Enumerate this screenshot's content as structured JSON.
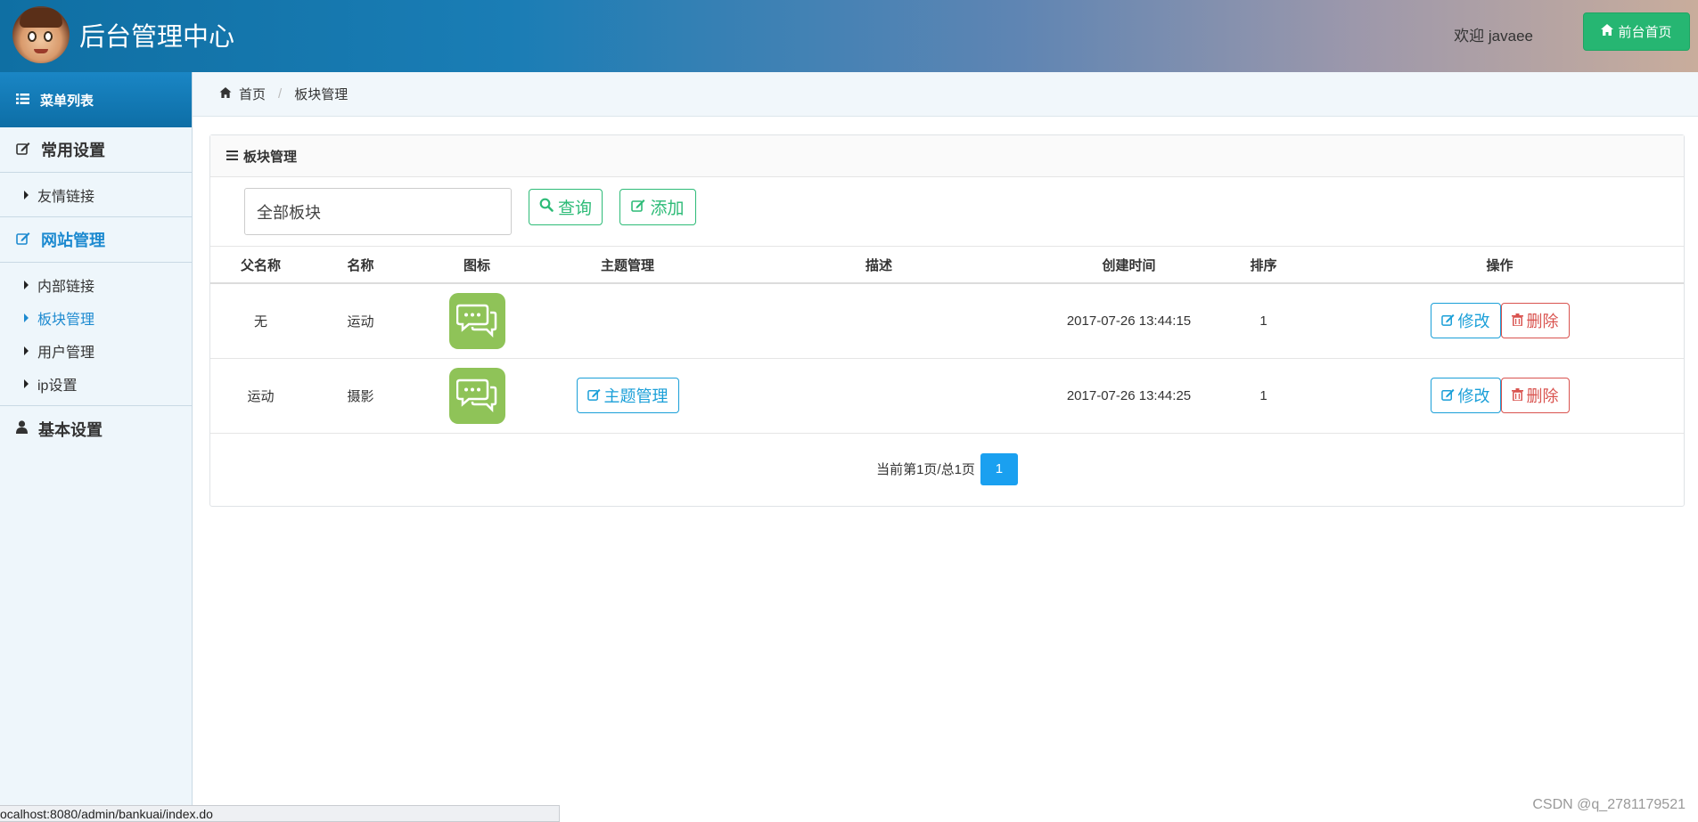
{
  "header": {
    "title": "后台管理中心",
    "welcome": "欢迎 javaee",
    "home_button": "前台首页"
  },
  "sidebar": {
    "menu_title": "菜单列表",
    "groups": [
      {
        "label": "常用设置",
        "items": [
          "友情链接"
        ]
      },
      {
        "label": "网站管理",
        "items": [
          "内部链接",
          "板块管理",
          "用户管理",
          "ip设置"
        ]
      },
      {
        "label": "基本设置",
        "items": []
      }
    ],
    "active_group": "网站管理",
    "active_item": "板块管理"
  },
  "breadcrumb": {
    "home": "首页",
    "current": "板块管理"
  },
  "panel": {
    "title": "板块管理",
    "filter_value": "全部板块",
    "query_button": "查询",
    "add_button": "添加"
  },
  "table": {
    "headers": [
      "父名称",
      "名称",
      "图标",
      "主题管理",
      "描述",
      "创建时间",
      "排序",
      "操作"
    ],
    "rows": [
      {
        "parent": "无",
        "name": "运动",
        "topic_button": "",
        "desc": "",
        "created": "2017-07-26 13:44:15",
        "order": "1",
        "edit": "修改",
        "delete": "删除"
      },
      {
        "parent": "运动",
        "name": "摄影",
        "topic_button": "主题管理",
        "desc": "",
        "created": "2017-07-26 13:44:25",
        "order": "1",
        "edit": "修改",
        "delete": "删除"
      }
    ]
  },
  "pager": {
    "info": "当前第1页/总1页",
    "current_page": "1"
  },
  "status_url": "ocalhost:8080/admin/bankuai/index.do",
  "watermark": "CSDN @q_2781179521",
  "colors": {
    "accent_green": "#26b672",
    "accent_blue": "#1a9fd8",
    "danger": "#d9534f",
    "icon_green": "#8fc358"
  }
}
